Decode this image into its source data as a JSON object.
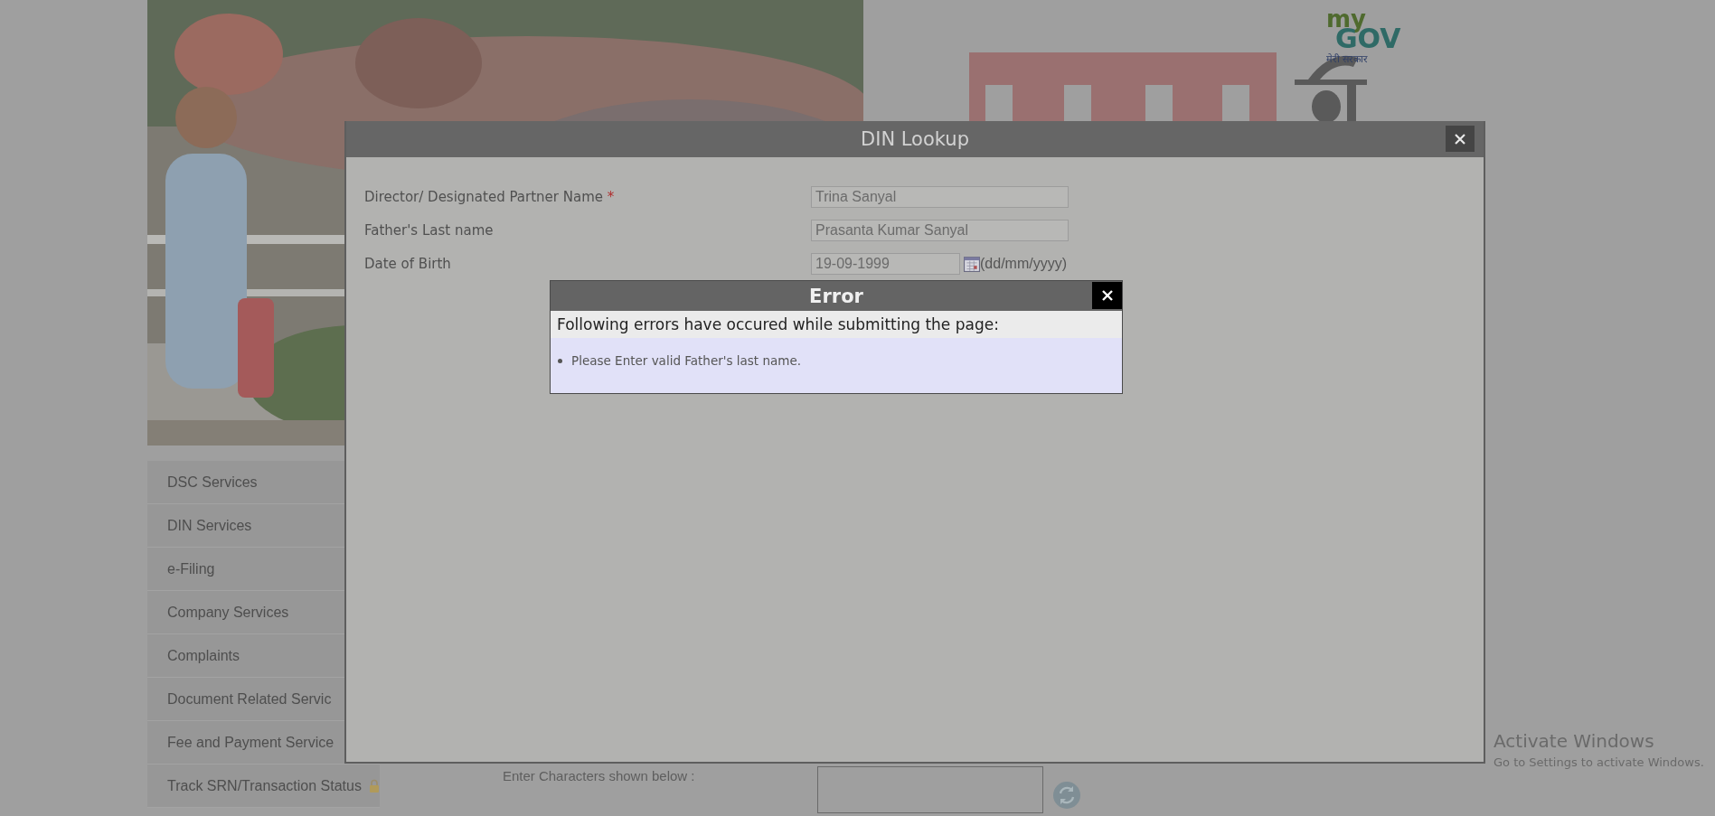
{
  "page": {
    "logo": {
      "line1": "my",
      "line2": "GOV",
      "tagline": "मेरी सरकार"
    },
    "sidebar": {
      "items": [
        {
          "label": "DSC Services",
          "locked": false
        },
        {
          "label": "DIN Services",
          "locked": false
        },
        {
          "label": "e-Filing",
          "locked": false
        },
        {
          "label": "Company Services",
          "locked": false
        },
        {
          "label": "Complaints",
          "locked": false
        },
        {
          "label": "Document Related Servic",
          "locked": false
        },
        {
          "label": "Fee and Payment Service",
          "locked": false
        },
        {
          "label": "Track SRN/Transaction Status",
          "locked": true
        }
      ]
    },
    "captcha": {
      "label": "Enter Characters shown below :"
    }
  },
  "dialog": {
    "title": "DIN Lookup",
    "fields": [
      {
        "kind": "text",
        "label": "Director/ Designated Partner Name",
        "required_mark": "*",
        "value": "Trina Sanyal"
      },
      {
        "kind": "text",
        "label": "Father's Last name",
        "value": "Prasanta Kumar Sanyal"
      },
      {
        "kind": "date",
        "label": "Date of Birth",
        "value": "19-09-1999",
        "hint": "(dd/mm/yyyy)"
      }
    ]
  },
  "error_dialog": {
    "title": "Error",
    "heading": "Following errors have occured while submitting the page:",
    "messages": [
      "Please Enter valid Father's last name."
    ]
  },
  "os_notice": {
    "title": "Activate Windows",
    "subtitle": "Go to Settings to activate Windows."
  }
}
